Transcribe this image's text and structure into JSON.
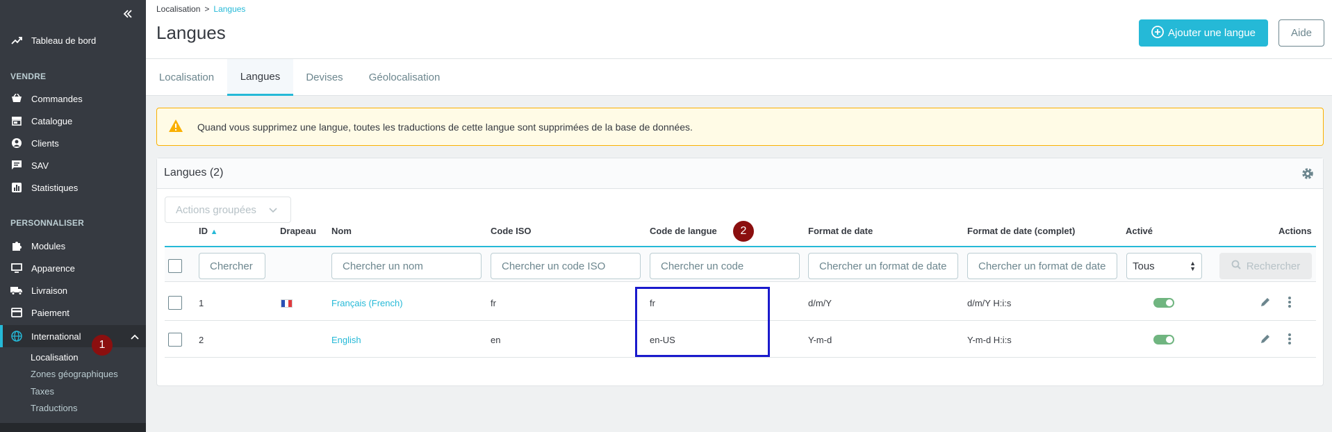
{
  "colors": {
    "accent": "#25b9d7",
    "sidebar_bg": "#363a41",
    "alert_border": "#fab000",
    "toggle_on": "#70b580",
    "annotation_badge": "#8b0f0f",
    "highlight_box": "#1a1acc"
  },
  "sidebar": {
    "dashboard_label": "Tableau de bord",
    "section_sell": "VENDRE",
    "sell_items": [
      {
        "label": "Commandes",
        "icon": "cart-icon"
      },
      {
        "label": "Catalogue",
        "icon": "store-icon"
      },
      {
        "label": "Clients",
        "icon": "user-circle-icon"
      },
      {
        "label": "SAV",
        "icon": "chat-icon"
      },
      {
        "label": "Statistiques",
        "icon": "chart-icon"
      }
    ],
    "section_customize": "PERSONNALISER",
    "customize_items": [
      {
        "label": "Modules",
        "icon": "puzzle-icon"
      },
      {
        "label": "Apparence",
        "icon": "monitor-icon"
      },
      {
        "label": "Livraison",
        "icon": "truck-icon"
      },
      {
        "label": "Paiement",
        "icon": "payment-icon"
      }
    ],
    "international_label": "International",
    "sub_items": [
      "Localisation",
      "Zones géographiques",
      "Taxes",
      "Traductions"
    ]
  },
  "header": {
    "breadcrumb_parent": "Localisation",
    "breadcrumb_sep": ">",
    "breadcrumb_current": "Langues",
    "title": "Langues",
    "add_button": "Ajouter une langue",
    "help_button": "Aide"
  },
  "tabs": [
    "Localisation",
    "Langues",
    "Devises",
    "Géolocalisation"
  ],
  "alert": {
    "message": "Quand vous supprimez une langue, toutes les traductions de cette langue sont supprimées de la base de données."
  },
  "grid": {
    "title": "Langues (2)",
    "bulk_actions": "Actions groupées",
    "columns": [
      "ID",
      "Drapeau",
      "Nom",
      "Code ISO",
      "Code de langue",
      "Format de date",
      "Format de date (complet)",
      "Activé",
      "Actions"
    ],
    "filters": {
      "id_placeholder": "Chercher",
      "name_placeholder": "Chercher un nom",
      "iso_placeholder": "Chercher un code ISO",
      "code_placeholder": "Chercher un code",
      "date_placeholder": "Chercher un format de date",
      "date_full_placeholder": "Chercher un format de date",
      "active_value": "Tous",
      "search_button": "Rechercher"
    },
    "rows": [
      {
        "id": "1",
        "name": "Français (French)",
        "iso": "fr",
        "code": "fr",
        "date_format": "d/m/Y",
        "date_format_full": "d/m/Y H:i:s",
        "active": true
      },
      {
        "id": "2",
        "name": "English",
        "iso": "en",
        "code": "en-US",
        "date_format": "Y-m-d",
        "date_format_full": "Y-m-d H:i:s",
        "active": true
      }
    ]
  },
  "annotations": {
    "badge_1": "1",
    "badge_2": "2"
  }
}
